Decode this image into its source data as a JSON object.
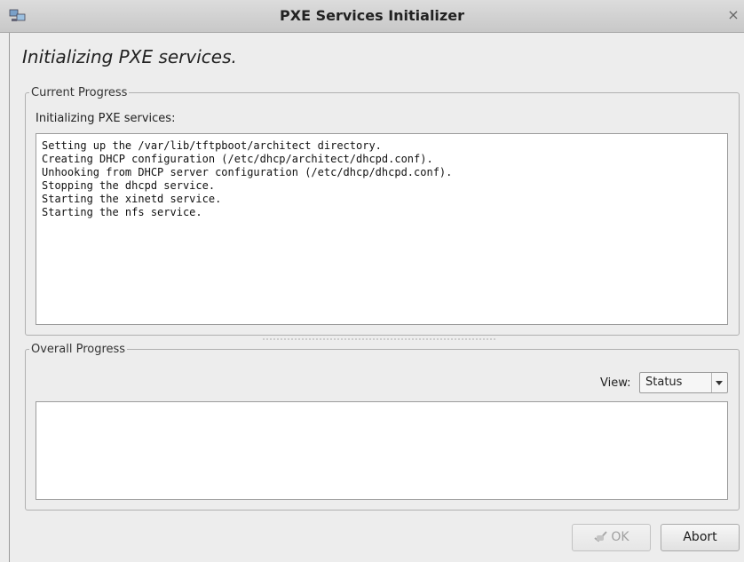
{
  "window": {
    "title": "PXE Services Initializer",
    "close_glyph": "×",
    "app_icon": "network-computer-icon",
    "close_icon": "close-icon"
  },
  "main": {
    "heading": "Initializing PXE services."
  },
  "current_progress": {
    "legend": "Current Progress",
    "label": "Initializing PXE services:",
    "log": [
      "Setting up the /var/lib/tftpboot/architect directory.",
      "Creating DHCP configuration (/etc/dhcp/architect/dhcpd.conf).",
      "Unhooking from DHCP server configuration (/etc/dhcp/dhcpd.conf).",
      "Stopping the dhcpd service.",
      "Starting the xinetd service.",
      "Starting the nfs service."
    ]
  },
  "overall_progress": {
    "legend": "Overall Progress",
    "view_label": "View:",
    "view_value": "Status",
    "status_text": ""
  },
  "buttons": {
    "ok_label": "OK",
    "ok_icon": "checkmark-hand-icon",
    "abort_label": "Abort"
  },
  "colors": {
    "titlebar": "#d2d2d2",
    "background": "#ededed",
    "border": "#b0b0b0"
  }
}
